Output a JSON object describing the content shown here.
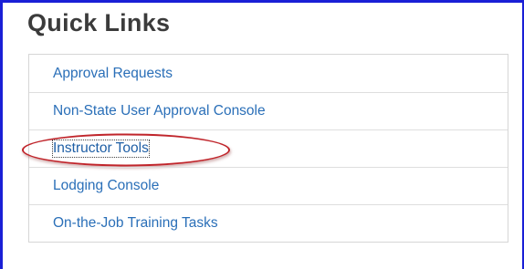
{
  "panel": {
    "title": "Quick Links"
  },
  "links": [
    {
      "label": "Approval Requests"
    },
    {
      "label": "Non-State User Approval Console"
    },
    {
      "label": "Instructor Tools"
    },
    {
      "label": "Lodging Console"
    },
    {
      "label": "On-the-Job Training Tasks"
    }
  ],
  "colors": {
    "link": "#2a6fb8",
    "frame": "#1a1fd6",
    "annotation_ring": "#c0252b",
    "title": "#3b3b3b"
  }
}
